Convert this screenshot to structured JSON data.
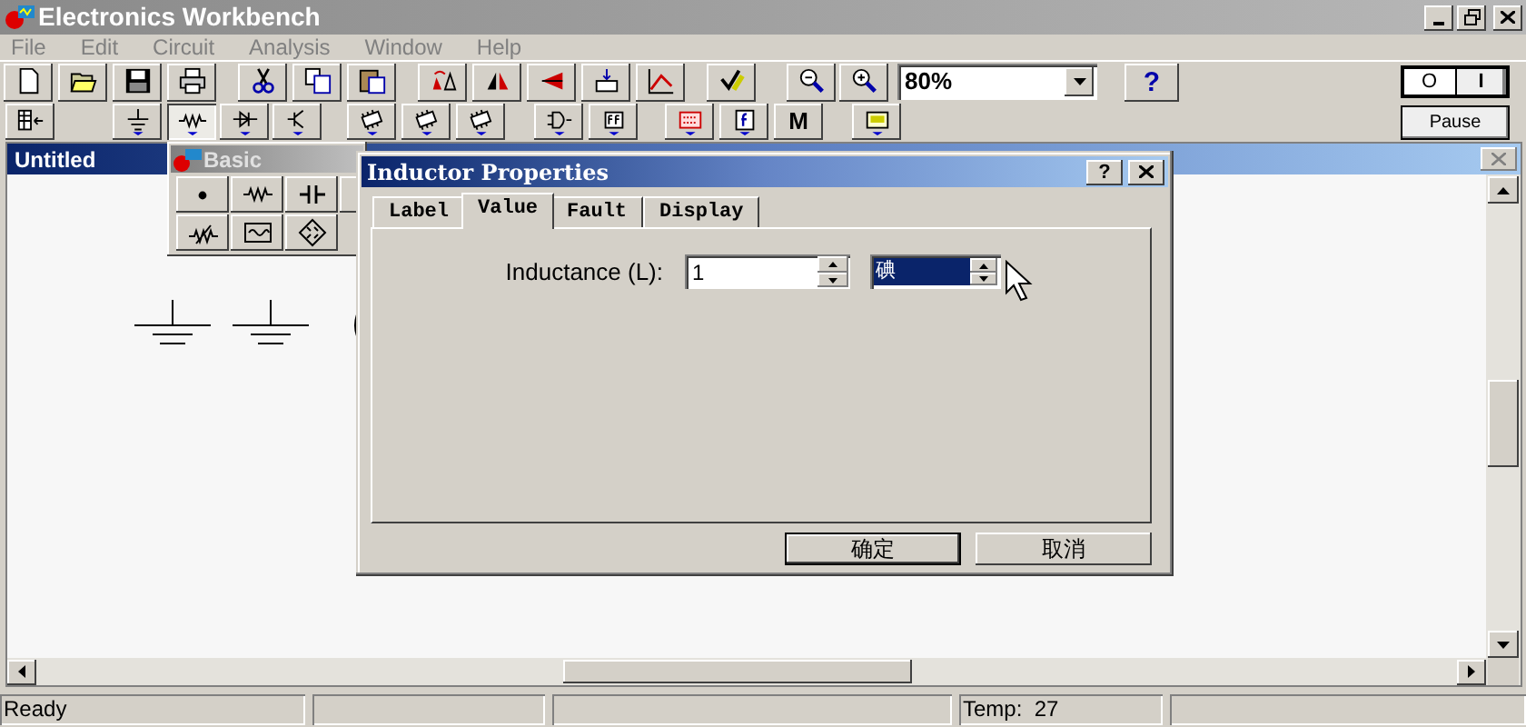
{
  "window": {
    "title": "Electronics Workbench"
  },
  "menu": [
    {
      "label": "File"
    },
    {
      "label": "Edit"
    },
    {
      "label": "Circuit"
    },
    {
      "label": "Analysis"
    },
    {
      "label": "Window"
    },
    {
      "label": "Help"
    }
  ],
  "zoom": {
    "value": "80%"
  },
  "help_button": "?",
  "power_switch": {
    "off_label": "O",
    "on_label": "I",
    "on": false
  },
  "pause_button": "Pause",
  "parts_bins": [
    {
      "selected": false
    },
    {
      "selected": false
    },
    {
      "selected": true
    },
    {
      "selected": false
    },
    {
      "selected": false
    },
    {
      "selected": false
    },
    {
      "selected": false
    },
    {
      "selected": false
    },
    {
      "selected": false
    },
    {
      "selected": false
    },
    {
      "selected": false
    },
    {
      "selected": false
    },
    {
      "selected": false,
      "label": "M"
    },
    {
      "selected": false
    }
  ],
  "document": {
    "title": "Untitled"
  },
  "palette": {
    "title": "Basic"
  },
  "dialog": {
    "title": "Inductor Properties",
    "help": "?",
    "tabs": [
      {
        "label": "Label",
        "selected": false
      },
      {
        "label": "Value",
        "selected": true
      },
      {
        "label": "Fault",
        "selected": false
      },
      {
        "label": "Display",
        "selected": false
      }
    ],
    "field_label": "Inductance (L):",
    "value": "1",
    "unit": "碘",
    "buttons": [
      {
        "label": "确定",
        "default": true
      },
      {
        "label": "取消",
        "default": false
      }
    ]
  },
  "status_bar": {
    "message": "Ready",
    "temperature": "Temp:  27"
  }
}
